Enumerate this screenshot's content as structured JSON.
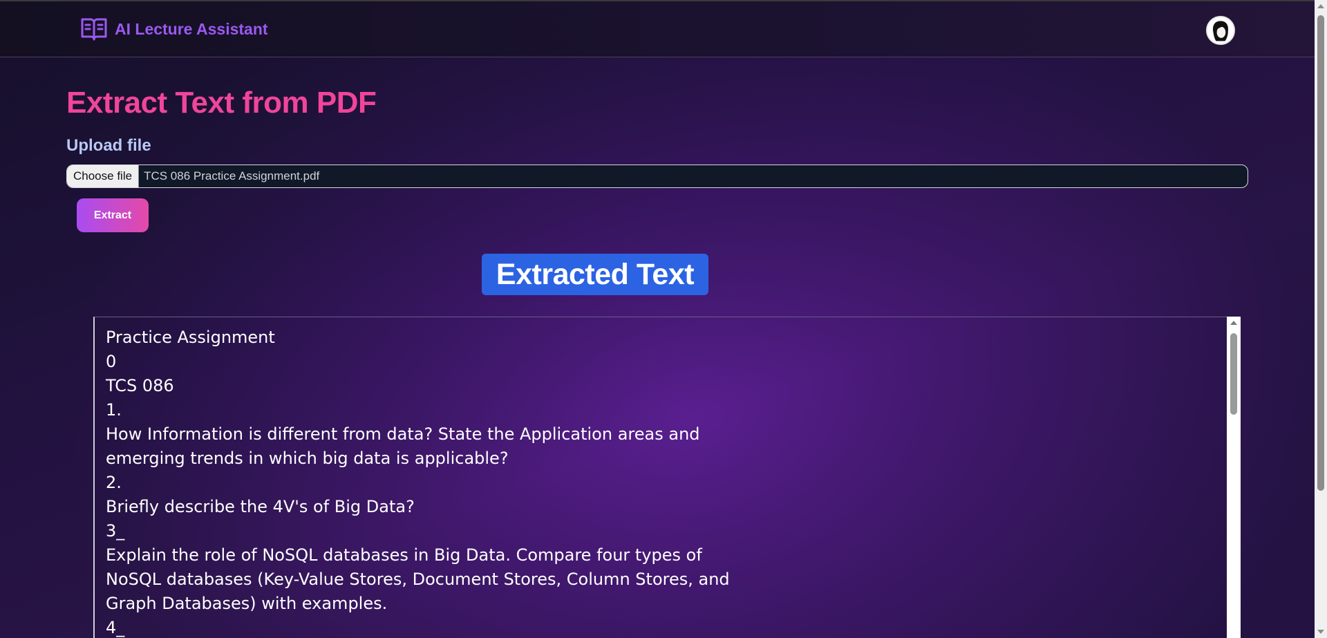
{
  "app": {
    "title": "AI Lecture Assistant",
    "brand_icon": "open-book-icon",
    "avatar_icon": "user-avatar-icon"
  },
  "page": {
    "title": "Extract Text from PDF",
    "upload_label": "Upload file",
    "file_input": {
      "button_label": "Choose file",
      "file_name": "TCS 086 Practice Assignment.pdf"
    },
    "extract_button": "Extract",
    "result_heading": "Extracted Text"
  },
  "extracted_text": {
    "lines": [
      "Practice Assignment",
      "0",
      "TCS 086",
      "1.",
      "How Information is different from data? State the Application areas and",
      "emerging trends in which big data is applicable?",
      "2.",
      "Briefly describe the 4V's of Big Data?",
      "3_",
      "Explain the role of NoSQL databases in Big Data. Compare four types of",
      "NoSQL databases (Key-Value Stores, Document Stores, Column Stores, and",
      "Graph Databases) with examples.",
      "4_"
    ]
  },
  "colors": {
    "brand": "#9b59f0",
    "title": "#f0459a",
    "heading_bg": "#2c63e3",
    "button_gradient_start": "#a84cf0",
    "button_gradient_end": "#e44aa8"
  }
}
